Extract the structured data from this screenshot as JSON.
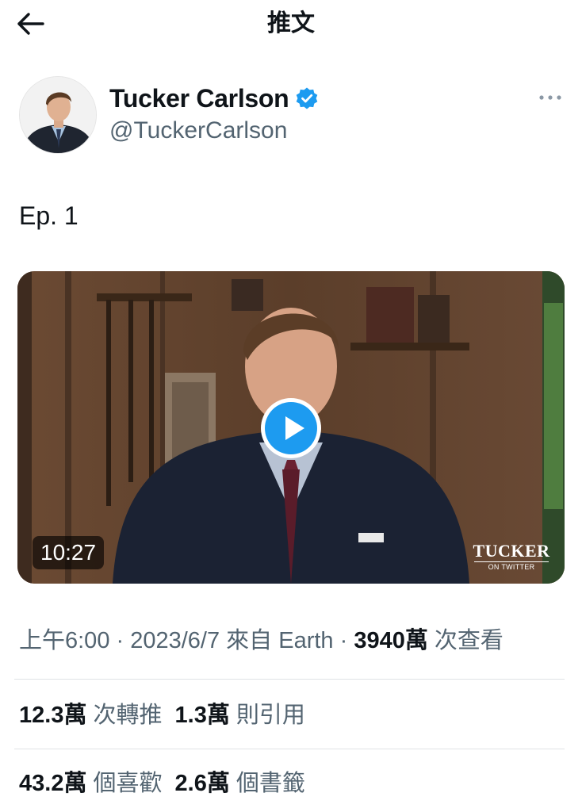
{
  "header": {
    "title": "推文",
    "back_icon": "arrow-left-icon"
  },
  "author": {
    "name": "Tucker Carlson",
    "handle": "@TuckerCarlson",
    "verified_color": "#1d9bf0",
    "verified_icon": "verified-badge-icon",
    "more_icon": "more-horizontal-icon"
  },
  "tweet": {
    "text": "Ep. 1"
  },
  "media": {
    "duration": "10:27",
    "watermark_main": "TUCKER",
    "watermark_sub": "ON TWITTER",
    "play_color": "#1d9bf0"
  },
  "meta": {
    "time": "上午6:00",
    "sep1": " · ",
    "date": "2023/6/7",
    "source_prefix": " 來自 ",
    "source": "Earth",
    "sep2": " · ",
    "views": "3940萬",
    "views_label": " 次查看"
  },
  "stats_row1": [
    {
      "value": "12.3萬",
      "label": " 次轉推"
    },
    {
      "value": "1.3萬",
      "label": " 則引用"
    }
  ],
  "stats_row2": [
    {
      "value": "43.2萬",
      "label": " 個喜歡"
    },
    {
      "value": "2.6萬",
      "label": " 個書籤"
    }
  ]
}
